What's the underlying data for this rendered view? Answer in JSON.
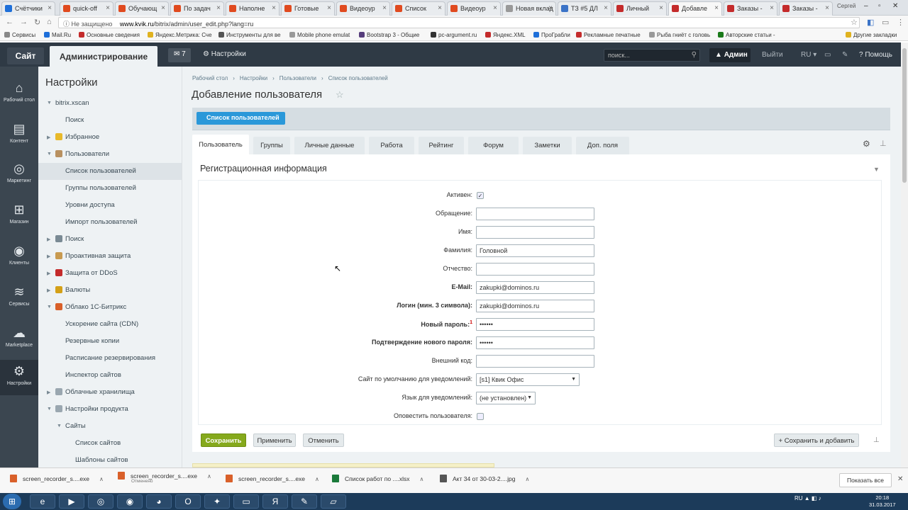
{
  "browser": {
    "tabs": [
      {
        "label": "Счётчики",
        "color": "#1e6fd9"
      },
      {
        "label": "quick-off",
        "color": "#e04a1f"
      },
      {
        "label": "Обучающ",
        "color": "#e04a1f"
      },
      {
        "label": "По задач",
        "color": "#e04a1f"
      },
      {
        "label": "Наполне",
        "color": "#e04a1f"
      },
      {
        "label": "Готовые",
        "color": "#e04a1f"
      },
      {
        "label": "Видеоур",
        "color": "#e04a1f"
      },
      {
        "label": "Список",
        "color": "#e04a1f"
      },
      {
        "label": "Видеоур",
        "color": "#e04a1f"
      },
      {
        "label": "Новая вклад",
        "color": "#999999"
      },
      {
        "label": "ТЗ #5 ДЛ",
        "color": "#3b73c7"
      },
      {
        "label": "Личный",
        "color": "#c42b2b"
      },
      {
        "label": "Добавле",
        "color": "#c42b2b"
      },
      {
        "label": "Заказы -",
        "color": "#c42b2b"
      },
      {
        "label": "Заказы -",
        "color": "#c42b2b"
      }
    ],
    "window_user": "Сергей",
    "address": {
      "security": "Не защищено",
      "domain": "www.kvik.ru",
      "path": "/bitrix/admin/user_edit.php?lang=ru"
    },
    "bookmarks": [
      {
        "label": "Сервисы",
        "color": "#888888"
      },
      {
        "label": "Mail.Ru",
        "color": "#1e6fd9"
      },
      {
        "label": "Основные сведения",
        "color": "#c42b2b"
      },
      {
        "label": "Яндекс.Метрика: Сче",
        "color": "#e0b21f"
      },
      {
        "label": "Инструменты для ве",
        "color": "#555555"
      },
      {
        "label": "Mobile phone emulat",
        "color": "#999999"
      },
      {
        "label": "Bootstrap 3 - Общие",
        "color": "#563d7c"
      },
      {
        "label": "pc-argument.ru",
        "color": "#333333"
      },
      {
        "label": "Яндекс.XML",
        "color": "#c42b2b"
      },
      {
        "label": "ПроГрабли",
        "color": "#1e6fd9"
      },
      {
        "label": "Рекламные печатные",
        "color": "#c42b2b"
      },
      {
        "label": "Рыба гниёт с головь",
        "color": "#999999"
      },
      {
        "label": "Авторские статьи - ",
        "color": "#1a7a1a"
      }
    ],
    "other_bookmarks": "Другие закладки"
  },
  "topbar": {
    "site": "Сайт",
    "admin": "Администрирование",
    "notif_count": "7",
    "settings": "Настройки",
    "search_placeholder": "поиск...",
    "user": "Админ",
    "logout": "Выйти",
    "lang": "RU",
    "help": "Помощь"
  },
  "iconbar": [
    {
      "label": "Рабочий стол",
      "icon": "home-icon",
      "glyph": "⌂"
    },
    {
      "label": "Контент",
      "icon": "document-icon",
      "glyph": "▤"
    },
    {
      "label": "Маркетинг",
      "icon": "target-icon",
      "glyph": "◎"
    },
    {
      "label": "Магазин",
      "icon": "basket-icon",
      "glyph": "⊞"
    },
    {
      "label": "Клиенты",
      "icon": "clients-icon",
      "glyph": "◉"
    },
    {
      "label": "Сервисы",
      "icon": "layers-icon",
      "glyph": "≋"
    },
    {
      "label": "Marketplace",
      "icon": "cloud-icon",
      "glyph": "☁"
    },
    {
      "label": "Настройки",
      "icon": "gear-icon",
      "glyph": "⚙"
    }
  ],
  "menu": {
    "title": "Настройки",
    "items": [
      {
        "label": "bitrix.xscan",
        "level": 0,
        "arrow": "▼",
        "icon": "",
        "color": ""
      },
      {
        "label": "Поиск",
        "level": 1,
        "arrow": "",
        "icon": "",
        "color": ""
      },
      {
        "label": "Избранное",
        "level": 0,
        "arrow": "▶",
        "icon": "star-icon",
        "color": "#e8b92a"
      },
      {
        "label": "Пользователи",
        "level": 0,
        "arrow": "▼",
        "icon": "users-icon",
        "color": "#b89060"
      },
      {
        "label": "Список пользователей",
        "level": 1,
        "arrow": "",
        "icon": "",
        "color": ""
      },
      {
        "label": "Группы пользователей",
        "level": 1,
        "arrow": "",
        "icon": "",
        "color": ""
      },
      {
        "label": "Уровни доступа",
        "level": 1,
        "arrow": "",
        "icon": "",
        "color": ""
      },
      {
        "label": "Импорт пользователей",
        "level": 1,
        "arrow": "",
        "icon": "",
        "color": ""
      },
      {
        "label": "Поиск",
        "level": 0,
        "arrow": "▶",
        "icon": "search-icon",
        "color": "#7a8a94"
      },
      {
        "label": "Проактивная защита",
        "level": 0,
        "arrow": "▶",
        "icon": "shield-icon",
        "color": "#c89a50"
      },
      {
        "label": "Защита от DDoS",
        "level": 0,
        "arrow": "▶",
        "icon": "ddos-icon",
        "color": "#c42b2b"
      },
      {
        "label": "Валюты",
        "level": 0,
        "arrow": "▶",
        "icon": "currency-icon",
        "color": "#d4a017"
      },
      {
        "label": "Облако 1С-Битрикс",
        "level": 0,
        "arrow": "▼",
        "icon": "cloud-icon",
        "color": "#d9602a"
      },
      {
        "label": "Ускорение сайта (CDN)",
        "level": 1,
        "arrow": "",
        "icon": "",
        "color": ""
      },
      {
        "label": "Резервные копии",
        "level": 1,
        "arrow": "",
        "icon": "",
        "color": ""
      },
      {
        "label": "Расписание резервирования",
        "level": 1,
        "arrow": "",
        "icon": "",
        "color": ""
      },
      {
        "label": "Инспектор сайтов",
        "level": 1,
        "arrow": "",
        "icon": "",
        "color": ""
      },
      {
        "label": "Облачные хранилища",
        "level": 0,
        "arrow": "▶",
        "icon": "storage-icon",
        "color": "#9aa7b0"
      },
      {
        "label": "Настройки продукта",
        "level": 0,
        "arrow": "▼",
        "icon": "gear-icon",
        "color": "#9aa7b0"
      },
      {
        "label": "Сайты",
        "level": 1,
        "arrow": "▼",
        "icon": "",
        "color": ""
      },
      {
        "label": "Список сайтов",
        "level": 2,
        "arrow": "",
        "icon": "",
        "color": ""
      },
      {
        "label": "Шаблоны сайтов",
        "level": 2,
        "arrow": "",
        "icon": "",
        "color": ""
      }
    ]
  },
  "main": {
    "breadcrumbs": [
      "Рабочий стол",
      "Настройки",
      "Пользователи",
      "Список пользователей"
    ],
    "title": "Добавление пользователя",
    "list_button": "Список пользователей",
    "tabs": [
      "Пользователь",
      "Группы",
      "Личные данные",
      "Работа",
      "Рейтинг",
      "Форум",
      "Заметки",
      "Доп. поля"
    ],
    "section_title": "Регистрационная информация",
    "fields": [
      {
        "label": "Активен:",
        "type": "checkbox",
        "checked": true,
        "value": "",
        "bold": false,
        "required": false
      },
      {
        "label": "Обращение:",
        "type": "text",
        "value": "",
        "bold": false,
        "required": false
      },
      {
        "label": "Имя:",
        "type": "text",
        "value": "",
        "bold": false,
        "required": false
      },
      {
        "label": "Фамилия:",
        "type": "text",
        "value": "Головной",
        "bold": false,
        "required": false
      },
      {
        "label": "Отчество:",
        "type": "text",
        "value": "",
        "bold": false,
        "required": false
      },
      {
        "label": "E-Mail:",
        "type": "text",
        "value": "zakupki@dominos.ru",
        "bold": true,
        "required": false
      },
      {
        "label": "Логин (мин. 3 символа):",
        "type": "text",
        "value": "zakupki@dominos.ru",
        "bold": true,
        "required": false
      },
      {
        "label": "Новый пароль:",
        "type": "password",
        "value": "••••••",
        "bold": true,
        "required": true
      },
      {
        "label": "Подтверждение нового пароля:",
        "type": "password",
        "value": "••••••",
        "bold": true,
        "required": false
      },
      {
        "label": "Внешний код:",
        "type": "text",
        "value": "",
        "bold": false,
        "required": false
      },
      {
        "label": "Сайт по умолчанию для уведомлений:",
        "type": "select",
        "value": "[s1] Квик Офис",
        "bold": false,
        "required": false
      },
      {
        "label": "Язык для уведомлений:",
        "type": "select",
        "value": "(не установлен)",
        "bold": false,
        "required": false
      },
      {
        "label": "Оповестить пользователя:",
        "type": "checkbox",
        "checked": false,
        "value": "",
        "bold": false,
        "required": false
      }
    ],
    "required_mark": "1",
    "buttons": {
      "save": "Сохранить",
      "apply": "Применить",
      "cancel": "Отменить",
      "save_add": "Сохранить и добавить"
    }
  },
  "downloads": {
    "items": [
      {
        "label": "screen_recorder_s....exe",
        "sub": "",
        "color": "#d9602a"
      },
      {
        "label": "screen_recorder_s....exe",
        "sub": "Отменено",
        "color": "#d9602a"
      },
      {
        "label": "screen_recorder_s....exe",
        "sub": "",
        "color": "#d9602a"
      },
      {
        "label": "Список работ по ....xlsx",
        "sub": "",
        "color": "#1a7a3a"
      },
      {
        "label": "Акт 34 от 30-03-2....jpg",
        "sub": "",
        "color": "#555555"
      }
    ],
    "show_all": "Показать все"
  },
  "taskbar": {
    "lang": "RU",
    "time": "20:18",
    "date": "31.03.2017"
  }
}
